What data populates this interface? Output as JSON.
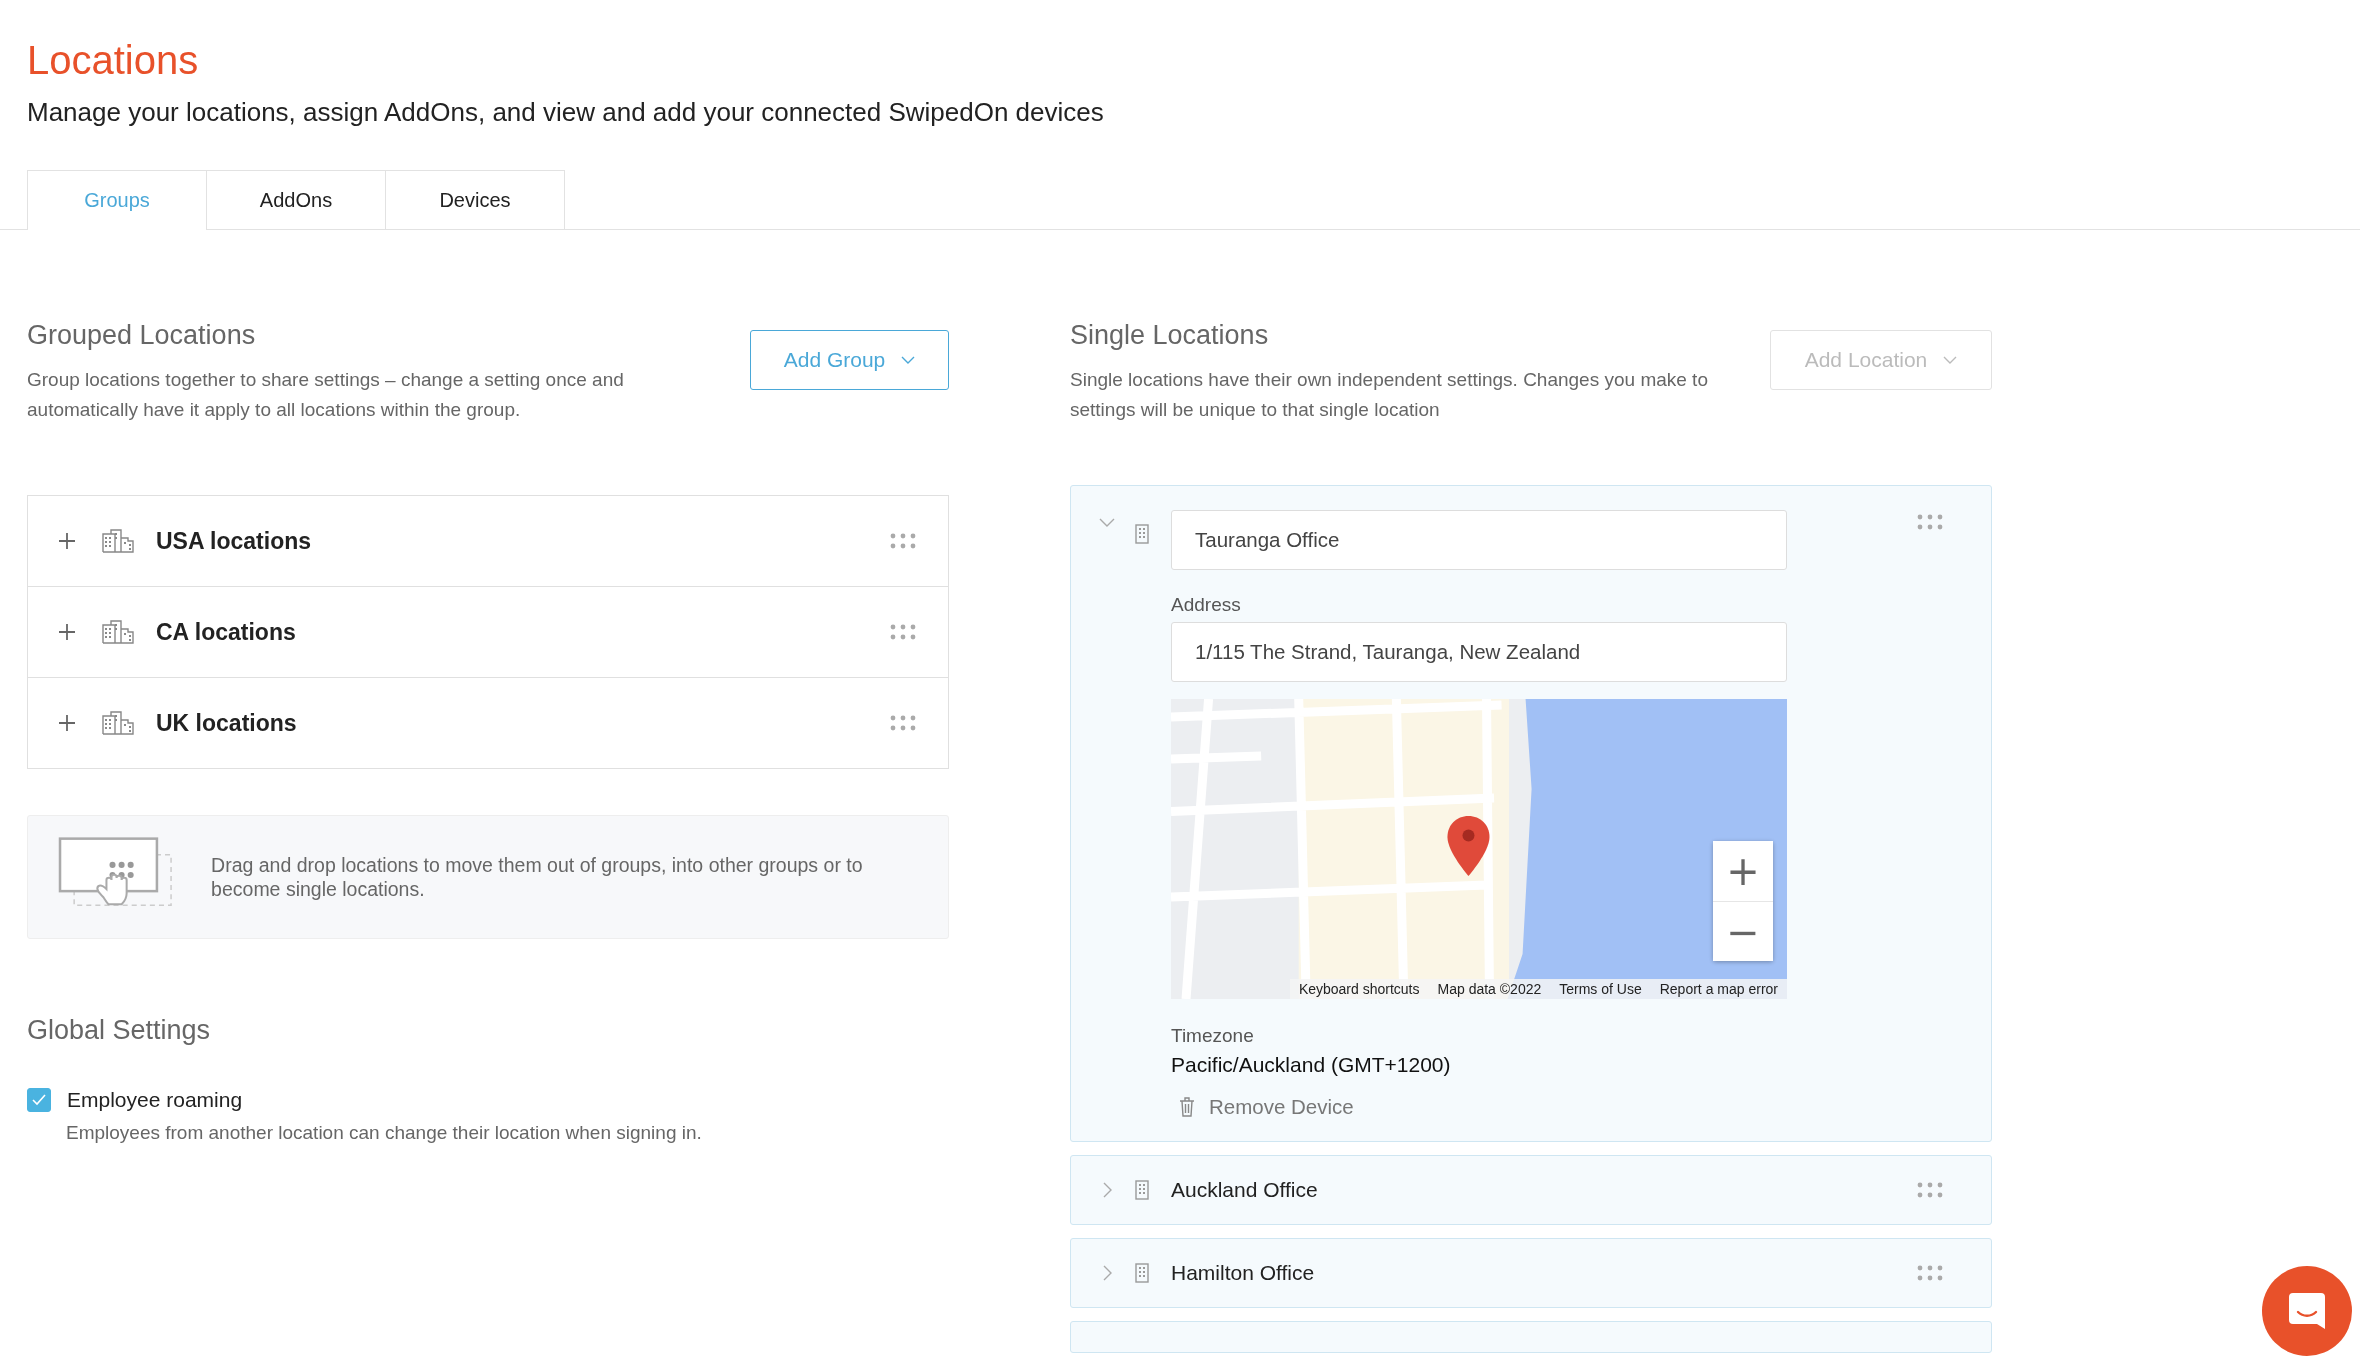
{
  "header": {
    "title": "Locations",
    "subtitle": "Manage your locations, assign AddOns, and view and add your connected SwipedOn devices"
  },
  "tabs": [
    {
      "label": "Groups",
      "selected": true
    },
    {
      "label": "AddOns",
      "selected": false
    },
    {
      "label": "Devices",
      "selected": false
    }
  ],
  "grouped": {
    "heading": "Grouped Locations",
    "description": "Group locations together to share settings – change a setting once and automatically have it apply to all locations within the group.",
    "add_button": {
      "label": "Add Group",
      "disabled": false
    },
    "groups": [
      {
        "name": "USA locations",
        "expanded": false
      },
      {
        "name": "CA locations",
        "expanded": false
      },
      {
        "name": "UK locations",
        "expanded": false
      }
    ],
    "hint": "Drag and drop locations to move them out of groups, into other groups or to become single locations."
  },
  "global_settings": {
    "heading": "Global Settings",
    "options": [
      {
        "label": "Employee roaming",
        "description": "Employees from another location can change their location when signing in.",
        "checked": true
      }
    ]
  },
  "single": {
    "heading": "Single Locations",
    "description": "Single locations have their own independent settings. Changes you make to settings will be unique to that single location",
    "add_button": {
      "label": "Add Location",
      "disabled": true
    },
    "locations": [
      {
        "name": "Tauranga Office",
        "expanded": true,
        "address_label": "Address",
        "address": "1/115 The Strand, Tauranga, New Zealand",
        "timezone_label": "Timezone",
        "timezone": "Pacific/Auckland (GMT+1200)",
        "remove_label": "Remove Device",
        "map": {
          "zoom_in": "+",
          "zoom_out": "−",
          "attribution": [
            "Keyboard shortcuts",
            "Map data ©2022",
            "Terms of Use",
            "Report a map error"
          ]
        }
      },
      {
        "name": "Auckland Office",
        "expanded": false
      },
      {
        "name": "Hamilton Office",
        "expanded": false
      }
    ]
  }
}
